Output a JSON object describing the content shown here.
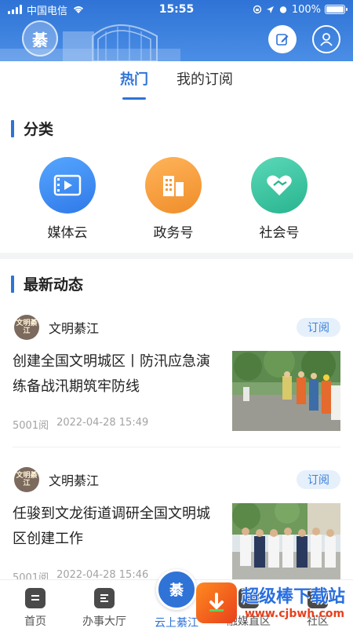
{
  "status_bar": {
    "carrier": "中国电信",
    "time": "15:55",
    "battery": "100%",
    "battery_level": 1.0
  },
  "header": {
    "logo_text": "綦",
    "edit_icon": "edit-icon",
    "user_icon": "user-icon"
  },
  "tabs": [
    {
      "label": "热门",
      "active": true
    },
    {
      "label": "我的订阅",
      "active": false
    }
  ],
  "categories_section": {
    "title": "分类",
    "items": [
      {
        "label": "媒体云",
        "icon": "video-icon",
        "color": "#3b8ff0"
      },
      {
        "label": "政务号",
        "icon": "building-icon",
        "color": "#f29a38"
      },
      {
        "label": "社会号",
        "icon": "heart-hands-icon",
        "color": "#3cc6a4"
      }
    ]
  },
  "news_section": {
    "title": "最新动态",
    "items": [
      {
        "source": "文明綦江",
        "avatar_text": "文明綦江",
        "subscribe": "订阅",
        "title": "创建全国文明城区丨防汛应急演练备战汛期筑牢防线",
        "views": "5001阅",
        "date": "2022-04-28 15:49"
      },
      {
        "source": "文明綦江",
        "avatar_text": "文明綦江",
        "subscribe": "订阅",
        "title": "任骏到文龙街道调研全国文明城区创建工作",
        "views": "5001阅",
        "date": "2022-04-28 15:46"
      }
    ]
  },
  "bottom_nav": {
    "items": [
      {
        "label": "首页",
        "icon": "home-icon"
      },
      {
        "label": "办事大厅",
        "icon": "service-hall-icon"
      },
      {
        "label": "云上綦江",
        "icon": "qijiang-logo-icon",
        "active": true
      },
      {
        "label": "融媒直区",
        "icon": "media-icon"
      },
      {
        "label": "社区",
        "icon": "community-icon"
      }
    ]
  },
  "watermark": {
    "text": "超级棒下载站",
    "url": "www.cjbwh.com"
  },
  "colors": {
    "accent": "#2f73d6",
    "subscribe_bg": "#e6f0fb"
  }
}
